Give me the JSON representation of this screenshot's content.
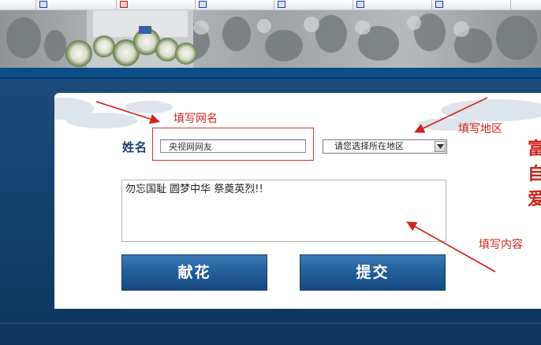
{
  "form": {
    "name_label": "姓名",
    "name_value": "央视网网友",
    "region_value": "请您选择所在地区",
    "content_value": "勿忘国耻 圆梦中华 祭奠英烈!!",
    "flower_button": "献花",
    "submit_button": "提交",
    "side_text": [
      "富",
      "自",
      "爱"
    ]
  },
  "annotations": {
    "name": "填写网名",
    "region": "填写地区",
    "content": "填写内容",
    "color": "#d4211c"
  },
  "colors": {
    "banner_bar": "#0c4d86",
    "button": "#245f9c",
    "label": "#1a3d6e"
  }
}
